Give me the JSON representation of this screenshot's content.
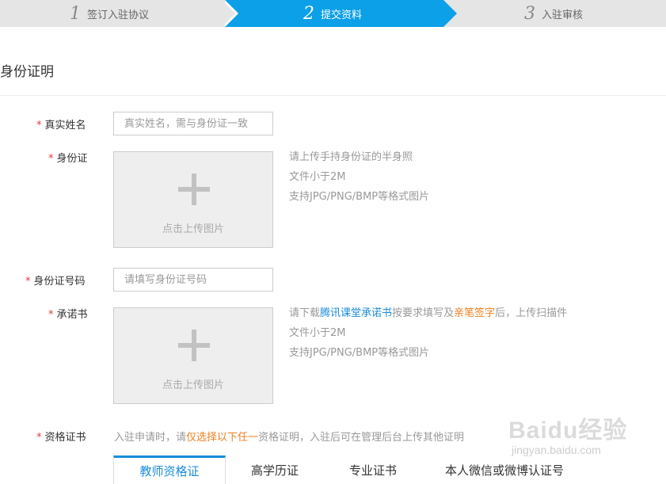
{
  "steps": [
    {
      "num": "1",
      "label": "签订入驻协议"
    },
    {
      "num": "2",
      "label": "提交资料"
    },
    {
      "num": "3",
      "label": "入驻审核"
    }
  ],
  "colors": {
    "accent": "#1a8cdb",
    "step_active": "#0ba0e8",
    "required": "#e4393c",
    "highlight": "#f08020"
  },
  "section_title": "身份证明",
  "required_mark": "*",
  "fields": {
    "real_name": {
      "label": "真实姓名",
      "placeholder": "真实姓名，需与身份证一致"
    },
    "id_card": {
      "label": "身份证",
      "upload_text": "点击上传图片",
      "hints": [
        "请上传手持身份证的半身照",
        "文件小于2M",
        "支持JPG/PNG/BMP等格式图片"
      ]
    },
    "id_number": {
      "label": "身份证号码",
      "placeholder": "请填写身份证号码"
    },
    "commitment": {
      "label": "承诺书",
      "upload_text": "点击上传图片",
      "hint_parts": [
        "请下载",
        "腾讯课堂承诺书",
        "按要求填写及",
        "亲笔签字",
        "后，上传扫描件"
      ],
      "hints": [
        "文件小于2M",
        "支持JPG/PNG/BMP等格式图片"
      ]
    },
    "qualification": {
      "label": "资格证书",
      "hint_parts": [
        "入驻申请时，请",
        "仅选择以下任一",
        "资格证明，入驻后可在管理后台上传其他证明"
      ],
      "tabs": [
        "教师资格证",
        "高学历证",
        "专业证书",
        "本人微信或微博认证号"
      ],
      "active_tab": 0
    }
  },
  "watermark": {
    "logo": "Baidu经验",
    "url": "jingyan.baidu.com"
  }
}
